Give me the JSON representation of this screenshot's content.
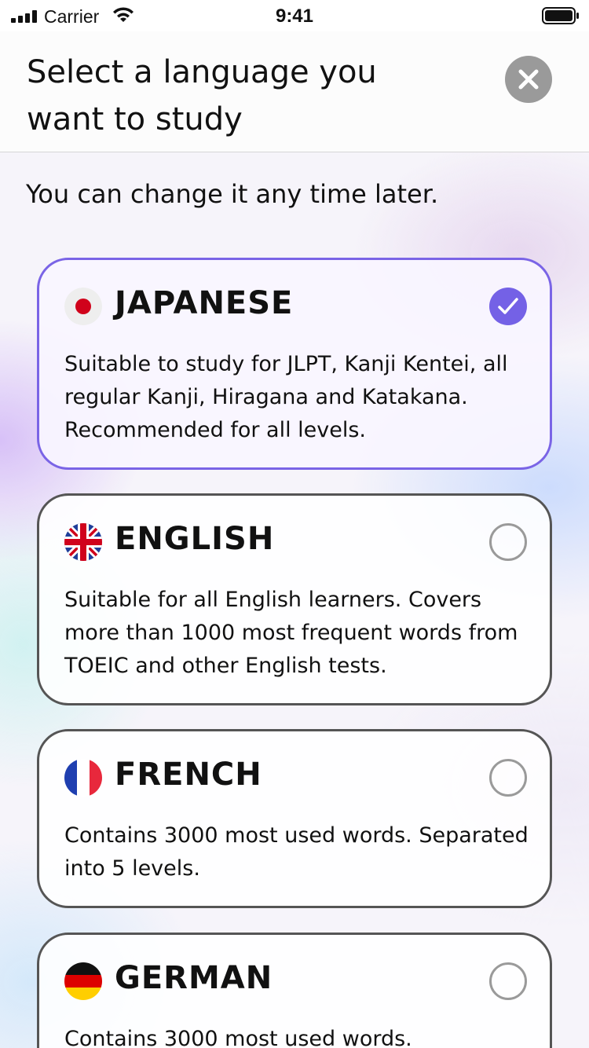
{
  "status_bar": {
    "carrier": "Carrier",
    "time": "9:41"
  },
  "header": {
    "title_line1": "Select a language you",
    "title_line2": "want to study",
    "close_icon": "close-icon"
  },
  "subtitle": "You can change it any time later.",
  "languages": [
    {
      "name": "JAPANESE",
      "flag_icon": "japan-flag-icon",
      "selected": true,
      "description": "Suitable to study for JLPT, Kanji Kentei, all regular Kanji, Hiragana and Katakana. Recommended for all levels."
    },
    {
      "name": "ENGLISH",
      "flag_icon": "uk-flag-icon",
      "selected": false,
      "description": "Suitable for all English learners. Covers more than 1000 most frequent words from TOEIC and other English tests."
    },
    {
      "name": "FRENCH",
      "flag_icon": "france-flag-icon",
      "selected": false,
      "description": "Contains 3000 most used words. Separated into 5 levels."
    },
    {
      "name": "GERMAN",
      "flag_icon": "germany-flag-icon",
      "selected": false,
      "description": "Contains 3000 most used words."
    }
  ],
  "colors": {
    "accent": "#7461e6",
    "selected_border": "#7a64e6",
    "card_border": "#555555",
    "radio_border": "#9a9a9a",
    "close_button": "#9a9a9a"
  }
}
